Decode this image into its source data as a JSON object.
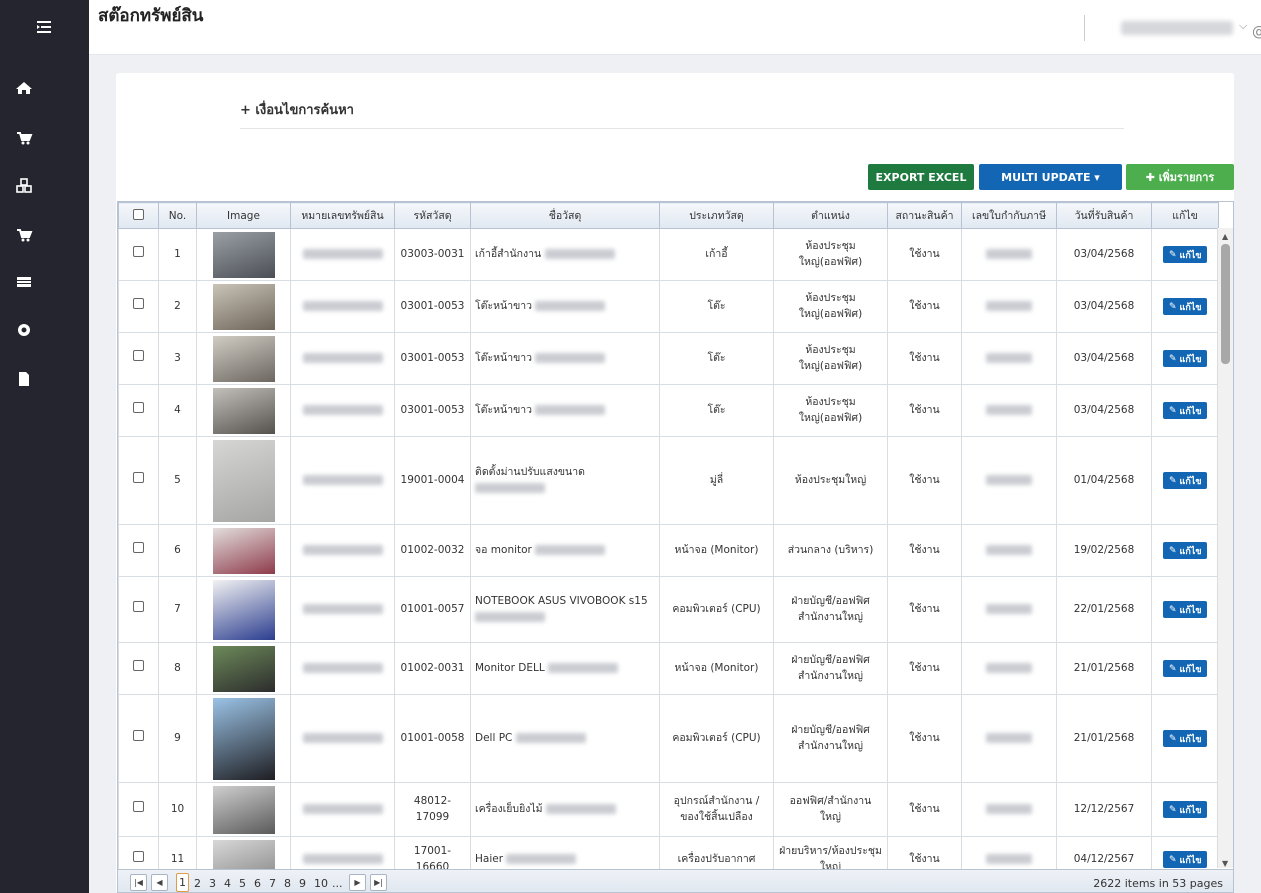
{
  "header": {
    "title": "สต๊อกทรัพย์สิน"
  },
  "panel": {
    "search_toggle": "+ เงื่อนไขการค้นหา",
    "buttons": {
      "export": "EXPORT EXCEL",
      "multi_update": "MULTI UPDATE ▾",
      "add": "✚ เพิ่มรายการ"
    }
  },
  "table": {
    "headers": [
      "No.",
      "Image",
      "หมายเลขทรัพย์สิน",
      "รหัสวัสดุ",
      "ชื่อวัสดุ",
      "ประเภทวัสดุ",
      "ตำแหน่ง",
      "สถานะสินค้า",
      "เลขใบกำกับภาษี",
      "วันที่รับสินค้า",
      "แก้ไข"
    ],
    "edit_label": "แก้ไข",
    "rows": [
      {
        "no": "1",
        "code": "03003-0031",
        "name": "เก้าอี้สำนักงาน",
        "type": "เก้าอี้",
        "location": "ห้องประชุม ใหญ่(ออฟฟิศ)",
        "status": "ใช้งาน",
        "date": "03/04/2568"
      },
      {
        "no": "2",
        "code": "03001-0053",
        "name": "โต๊ะหน้าขาว",
        "type": "โต๊ะ",
        "location": "ห้องประชุม ใหญ่(ออฟฟิศ)",
        "status": "ใช้งาน",
        "date": "03/04/2568"
      },
      {
        "no": "3",
        "code": "03001-0053",
        "name": "โต๊ะหน้าขาว",
        "type": "โต๊ะ",
        "location": "ห้องประชุม ใหญ่(ออฟฟิศ)",
        "status": "ใช้งาน",
        "date": "03/04/2568"
      },
      {
        "no": "4",
        "code": "03001-0053",
        "name": "โต๊ะหน้าขาว",
        "type": "โต๊ะ",
        "location": "ห้องประชุม ใหญ่(ออฟฟิศ)",
        "status": "ใช้งาน",
        "date": "03/04/2568"
      },
      {
        "no": "5",
        "code": "19001-0004",
        "name": "ติดตั้งม่านปรับแสงขนาด",
        "type": "มู่ลี่",
        "location": "ห้องประชุมใหญ่",
        "status": "ใช้งาน",
        "date": "01/04/2568"
      },
      {
        "no": "6",
        "code": "01002-0032",
        "name": "จอ monitor",
        "type": "หน้าจอ (Monitor)",
        "location": "ส่วนกลาง (บริหาร)",
        "status": "ใช้งาน",
        "date": "19/02/2568"
      },
      {
        "no": "7",
        "code": "01001-0057",
        "name": "NOTEBOOK ASUS VIVOBOOK s15",
        "type": "คอมพิวเตอร์ (CPU)",
        "location": "ฝ่ายบัญชี/ออฟฟิศ สำนักงานใหญ่",
        "status": "ใช้งาน",
        "date": "22/01/2568"
      },
      {
        "no": "8",
        "code": "01002-0031",
        "name": "Monitor DELL",
        "type": "หน้าจอ (Monitor)",
        "location": "ฝ่ายบัญชี/ออฟฟิศ สำนักงานใหญ่",
        "status": "ใช้งาน",
        "date": "21/01/2568"
      },
      {
        "no": "9",
        "code": "01001-0058",
        "name": "Dell PC",
        "type": "คอมพิวเตอร์ (CPU)",
        "location": "ฝ่ายบัญชี/ออฟฟิศ สำนักงานใหญ่",
        "status": "ใช้งาน",
        "date": "21/01/2568"
      },
      {
        "no": "10",
        "code": "48012- 17099",
        "name": "เครื่องเย็บยิงไม้",
        "type": "อุปกรณ์สำนักงาน / ของใช้สิ้นเปลือง",
        "location": "ออฟฟิศ/สำนักงาน ใหญ่",
        "status": "ใช้งาน",
        "date": "12/12/2567"
      },
      {
        "no": "11",
        "code": "17001- 16660",
        "name": "Haier",
        "type": "เครื่องปรับอากาศ",
        "location": "ฝ่ายบริหาร/ห้องประชุม ใหญ่",
        "status": "ใช้งาน",
        "date": "04/12/2567"
      }
    ]
  },
  "pager": {
    "pages": [
      "1",
      "2",
      "3",
      "4",
      "5",
      "6",
      "7",
      "8",
      "9",
      "10",
      "..."
    ],
    "info": "2622 items in 53 pages"
  },
  "icons": {
    "sidebar": [
      "menu-icon",
      "home-icon",
      "cart-icon",
      "cubes-icon",
      "cart-icon",
      "list-icon",
      "cog-icon",
      "file-icon"
    ]
  }
}
